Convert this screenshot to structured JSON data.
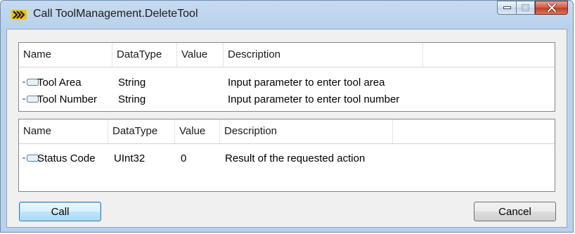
{
  "window": {
    "title": "Call ToolManagement.DeleteTool",
    "icon": "uaexpert-app-icon",
    "caption_buttons": [
      "minimize-icon",
      "maximize-icon",
      "close-icon"
    ]
  },
  "input_arguments": {
    "columns": [
      "Name",
      "DataType",
      "Value",
      "Description"
    ],
    "rows": [
      {
        "icon": "input-parameter-icon",
        "name": "Tool Area",
        "datatype": "String",
        "value": "",
        "description": "Input parameter to enter tool area"
      },
      {
        "icon": "input-parameter-icon",
        "name": "Tool Number",
        "datatype": "String",
        "value": "",
        "description": "Input parameter to enter tool number"
      }
    ]
  },
  "output_arguments": {
    "columns": [
      "Name",
      "DataType",
      "Value",
      "Description"
    ],
    "rows": [
      {
        "icon": "output-parameter-icon",
        "name": "Status Code",
        "datatype": "UInt32",
        "value": "0",
        "description": "Result of the requested action"
      }
    ]
  },
  "buttons": {
    "call_label": "Call",
    "cancel_label": "Cancel"
  }
}
